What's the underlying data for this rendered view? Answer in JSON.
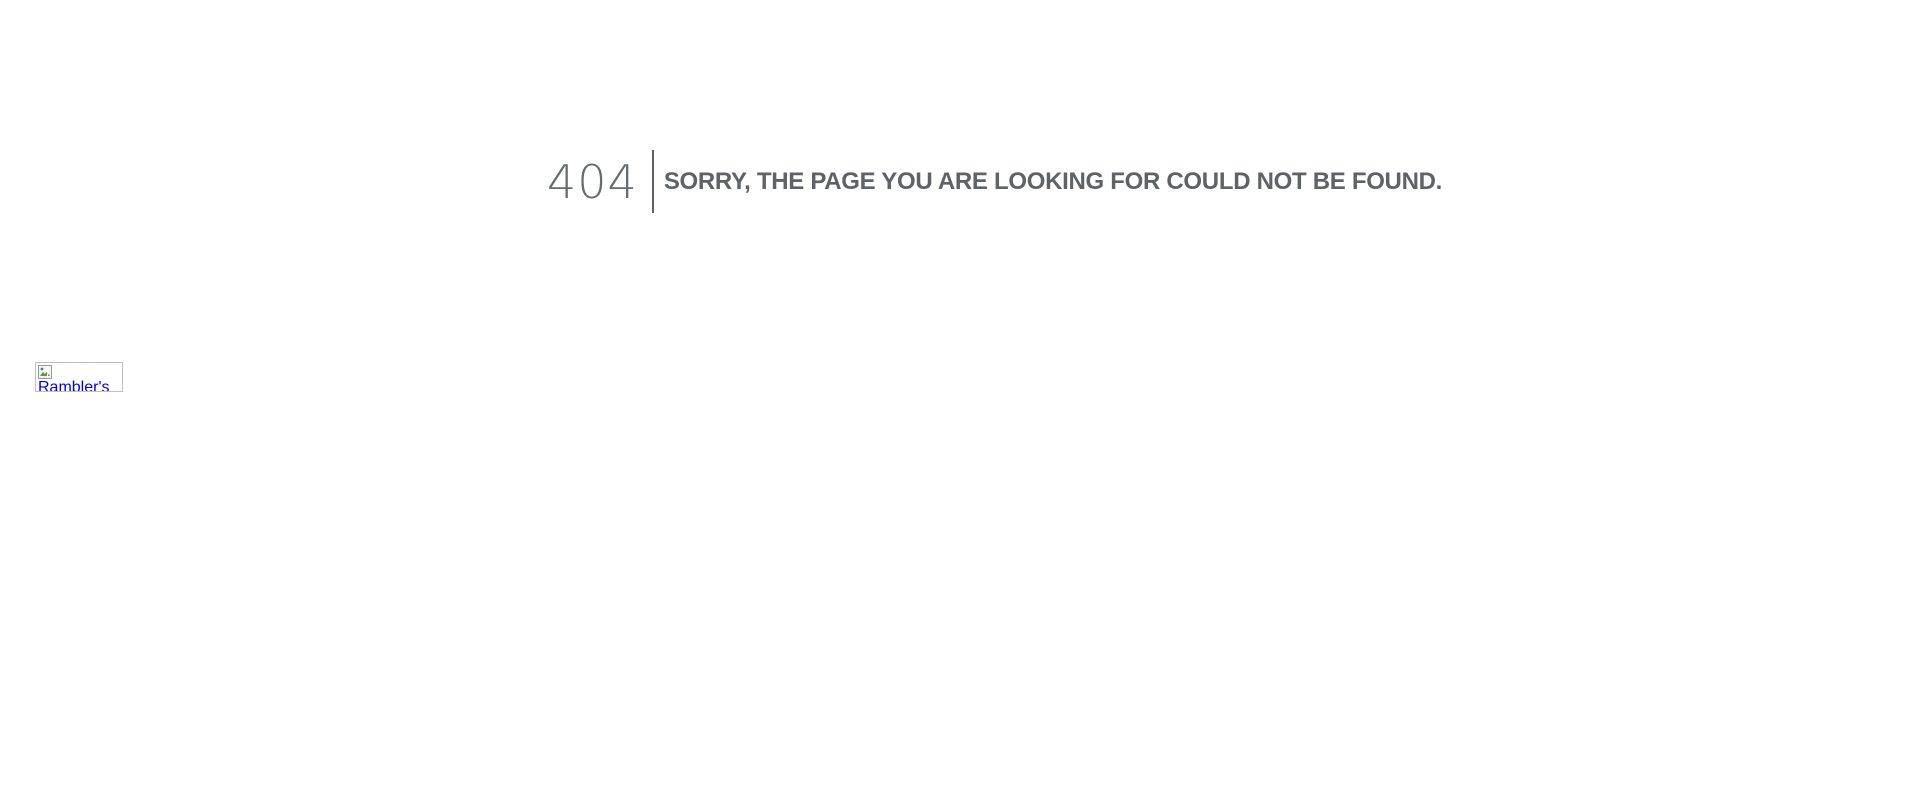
{
  "error": {
    "code": "404",
    "message": "SORRY, THE PAGE YOU ARE LOOKING FOR COULD NOT BE FOUND."
  },
  "badge": {
    "alt_text": "Rambler's",
    "link_color": "#0000ee"
  },
  "colors": {
    "text": "#5f6368",
    "background": "#ffffff"
  },
  "icons": {
    "broken_image": "broken-image-icon"
  }
}
